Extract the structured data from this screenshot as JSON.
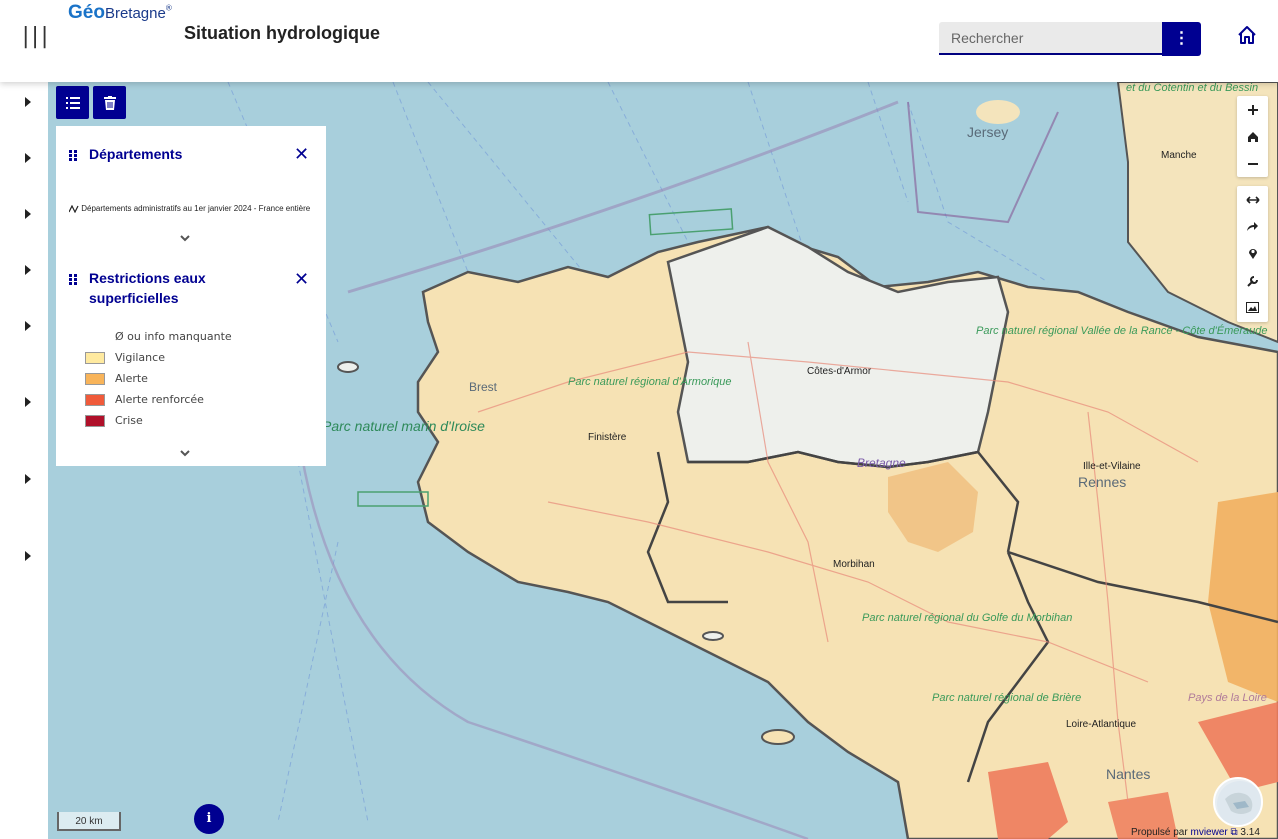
{
  "header": {
    "logo_geo": "Géo",
    "logo_bretagne": "Bretagne",
    "logo_reg": "®",
    "title": "Situation hydrologique",
    "search_placeholder": "Rechercher",
    "menu_glyph": "⋮"
  },
  "legend": {
    "panel1": {
      "title": "Départements",
      "layer_desc": "Départements administratifs au 1er janvier 2024 - France entière"
    },
    "panel2": {
      "title_line1": "Restrictions eaux",
      "title_line2": "superficielles",
      "items": [
        {
          "label": "Ø ou info manquante",
          "color": ""
        },
        {
          "label": "Vigilance",
          "color": "#ffeaa0"
        },
        {
          "label": "Alerte",
          "color": "#f8b45a"
        },
        {
          "label": "Alerte renforcée",
          "color": "#f05a3a"
        },
        {
          "label": "Crise",
          "color": "#b0102a"
        }
      ]
    }
  },
  "map_labels": {
    "jersey": "Jersey",
    "manche": "Manche",
    "cotes_armor": "Côtes-d'Armor",
    "finistere": "Finistère",
    "bretagne": "Bretagne",
    "morbihan": "Morbihan",
    "ille_vilaine": "Ille-et-Vilaine",
    "rennes": "Rennes",
    "loire_atlantique": "Loire-Atlantique",
    "nantes": "Nantes",
    "brest": "Brest",
    "cotentin": "et du Cotentin et du Bessin",
    "parc_armorique": "Parc naturel régional d'Armorique",
    "parc_iroise": "Parc naturel marin d'Iroise",
    "parc_rance": "Parc naturel régional Vallée de la Rance - Côte d'Émeraude",
    "parc_golfe": "Parc naturel régional du Golfe du Morbihan",
    "parc_briere": "Parc naturel régional de Brière",
    "pays_loire": "Pays de la Loire"
  },
  "footer": {
    "scale": "20 km",
    "info": "i",
    "credit_prefix": "Propulsé par",
    "credit_link": "mviewer",
    "version": "3.14"
  },
  "colors": {
    "accent": "#000091",
    "sea": "#a8cfdc",
    "land_vigilance": "#f7e3b0",
    "land_alerte": "#f2c282",
    "land_alerte_renforcee": "#ef8a6e",
    "land_none": "#eef0ee"
  }
}
